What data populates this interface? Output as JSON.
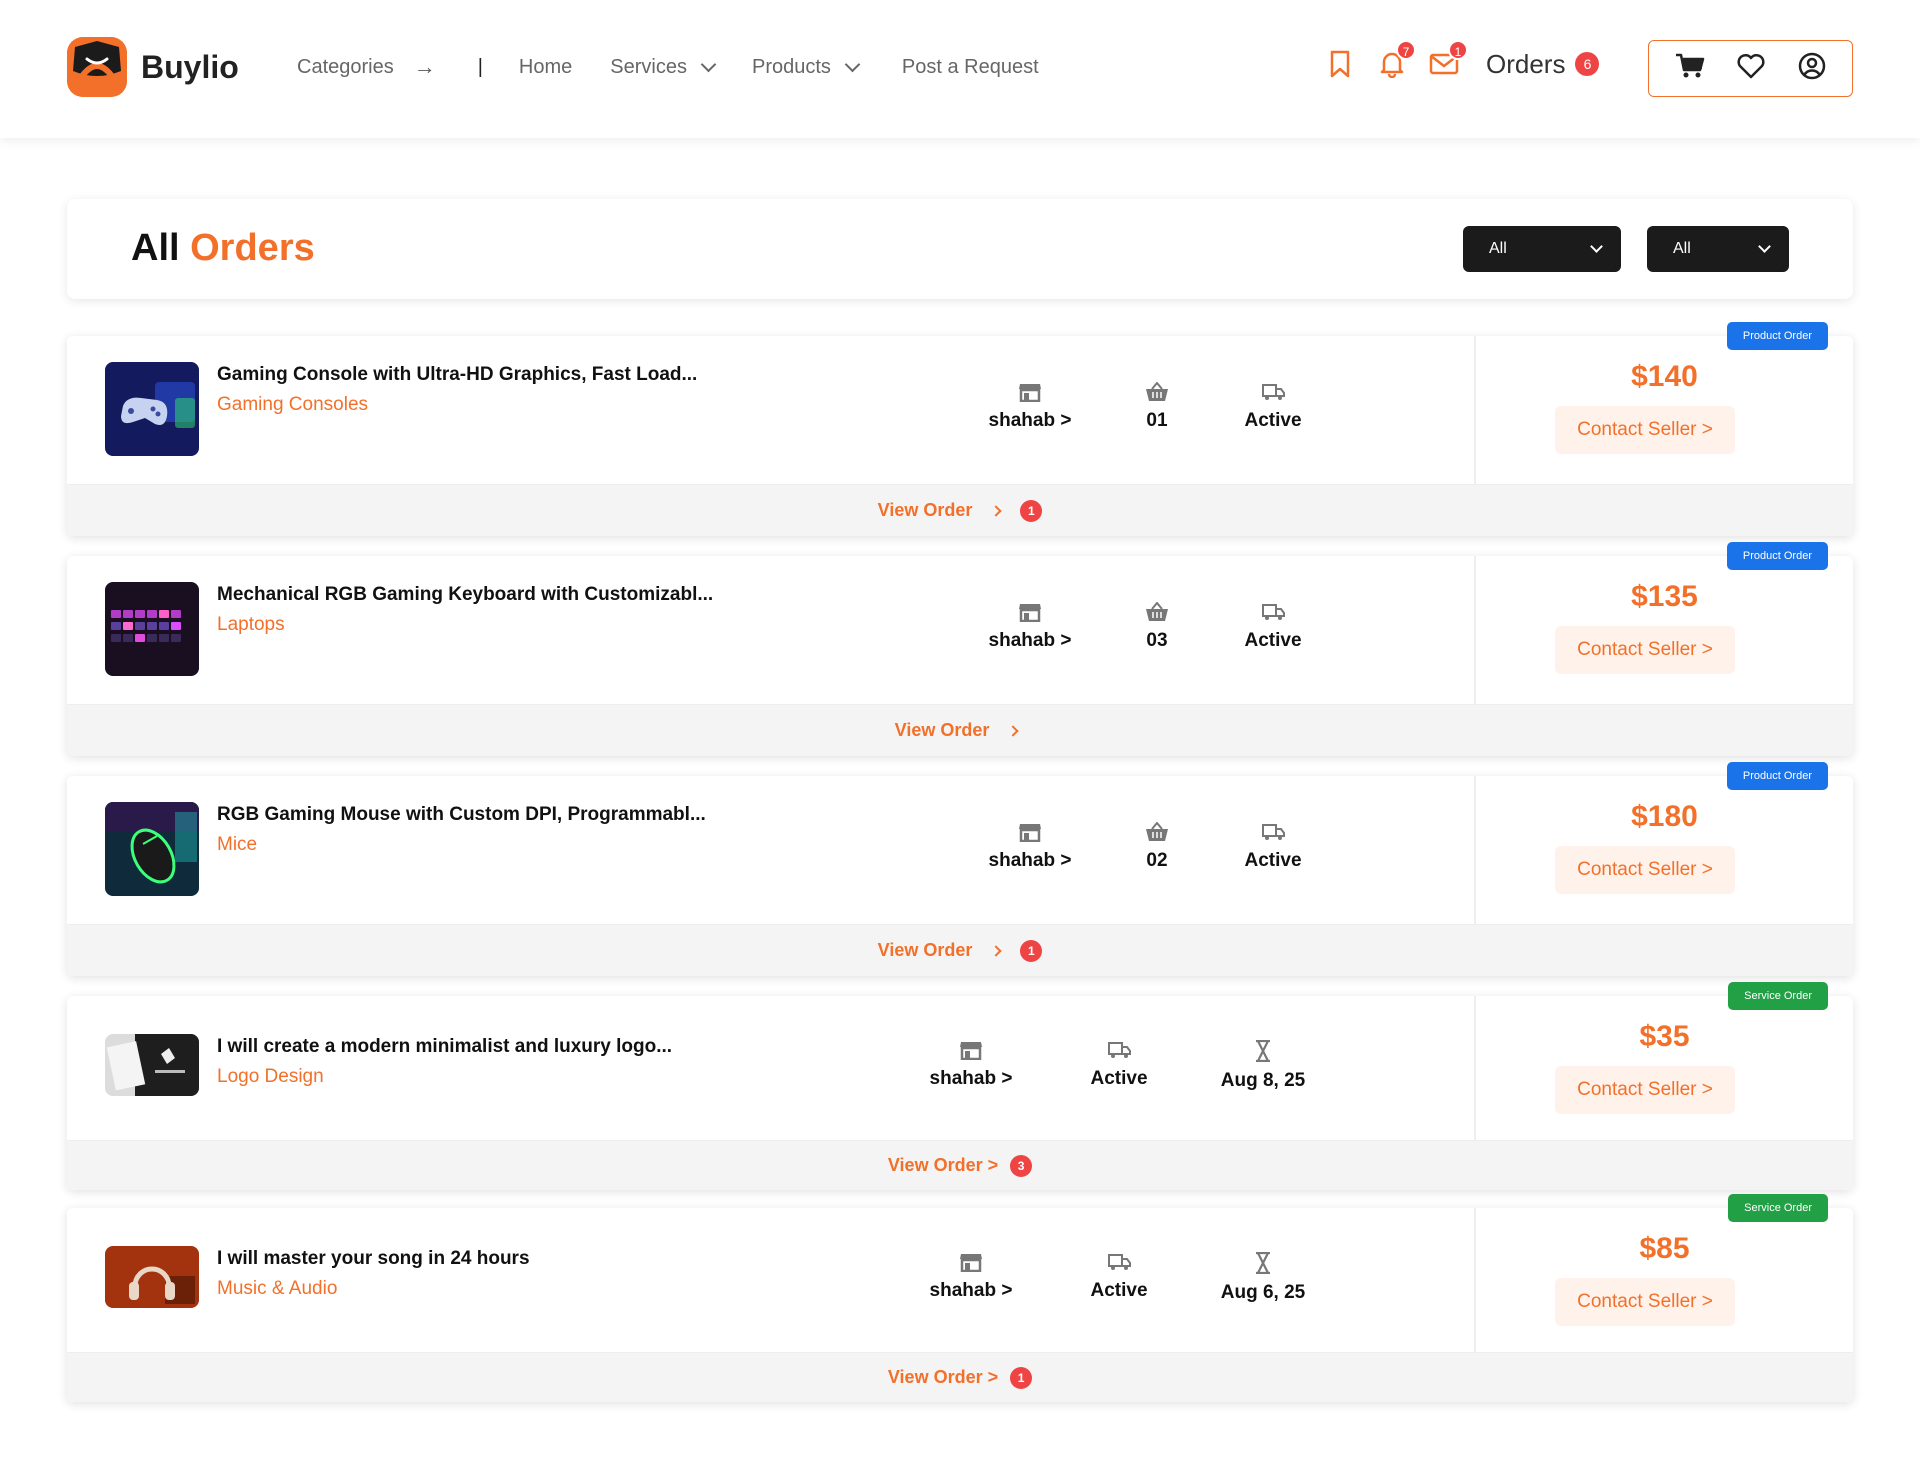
{
  "brand": {
    "name": "Buylio"
  },
  "nav": {
    "categories": "Categories",
    "separator": "|",
    "home": "Home",
    "services": "Services",
    "products": "Products",
    "post_request": "Post a Request"
  },
  "header": {
    "notifications_count": "7",
    "messages_count": "1",
    "orders_label": "Orders",
    "orders_count": "6"
  },
  "page": {
    "title_part1": "All",
    "title_part2": "Orders",
    "filter1": "All",
    "filter2": "All"
  },
  "colors": {
    "accent": "#f2702a",
    "badge_red": "#ef4444",
    "product_blue": "#1a73e8",
    "service_green": "#22a045"
  },
  "orders": [
    {
      "type_label": "Product Order",
      "title": "Gaming Console with Ultra-HD Graphics, Fast Load...",
      "category": "Gaming Consoles",
      "seller": "shahab >",
      "quantity": "01",
      "status": "Active",
      "price": "$140",
      "contact": "Contact Seller >",
      "view": "View Order",
      "view_badge": "1"
    },
    {
      "type_label": "Product Order",
      "title": "Mechanical RGB Gaming Keyboard with Customizabl...",
      "category": "Laptops",
      "seller": "shahab >",
      "quantity": "03",
      "status": "Active",
      "price": "$135",
      "contact": "Contact Seller >",
      "view": "View Order"
    },
    {
      "type_label": "Product Order",
      "title": "RGB Gaming Mouse with Custom DPI, Programmabl...",
      "category": "Mice",
      "seller": "shahab >",
      "quantity": "02",
      "status": "Active",
      "price": "$180",
      "contact": "Contact Seller >",
      "view": "View Order",
      "view_badge": "1"
    },
    {
      "type_label": "Service Order",
      "title": "I will create a modern minimalist and luxury logo...",
      "category": "Logo Design",
      "seller": "shahab >",
      "status": "Active",
      "date": "Aug 8, 25",
      "price": "$35",
      "contact": "Contact Seller >",
      "view": "View Order >",
      "view_badge": "3"
    },
    {
      "type_label": "Service Order",
      "title": "I will master your song in 24 hours",
      "category": "Music & Audio",
      "seller": "shahab >",
      "status": "Active",
      "date": "Aug 6, 25",
      "price": "$85",
      "contact": "Contact Seller >",
      "view": "View Order >",
      "view_badge": "1"
    }
  ]
}
